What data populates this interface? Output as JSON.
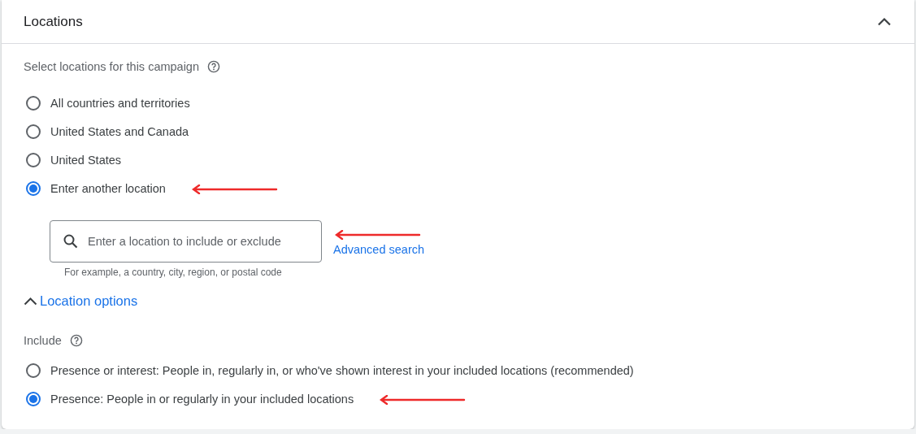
{
  "panel": {
    "title": "Locations",
    "expanded": true
  },
  "locations": {
    "label": "Select locations for this campaign",
    "options": [
      {
        "label": "All countries and territories",
        "selected": false,
        "annotated": false
      },
      {
        "label": "United States and Canada",
        "selected": false,
        "annotated": false
      },
      {
        "label": "United States",
        "selected": false,
        "annotated": false
      },
      {
        "label": "Enter another location",
        "selected": true,
        "annotated": true
      }
    ]
  },
  "search": {
    "placeholder": "Enter a location to include or exclude",
    "hint": "For example, a country, city, region, or postal code",
    "annotated": true
  },
  "advanced_search": "Advanced search",
  "location_options": {
    "label": "Location options",
    "expanded": true
  },
  "include": {
    "label": "Include",
    "options": [
      {
        "label": "Presence or interest: People in, regularly in, or who've shown interest in your included locations (recommended)",
        "selected": false,
        "annotated": false
      },
      {
        "label": "Presence: People in or regularly in your included locations",
        "selected": true,
        "annotated": true
      }
    ]
  }
}
